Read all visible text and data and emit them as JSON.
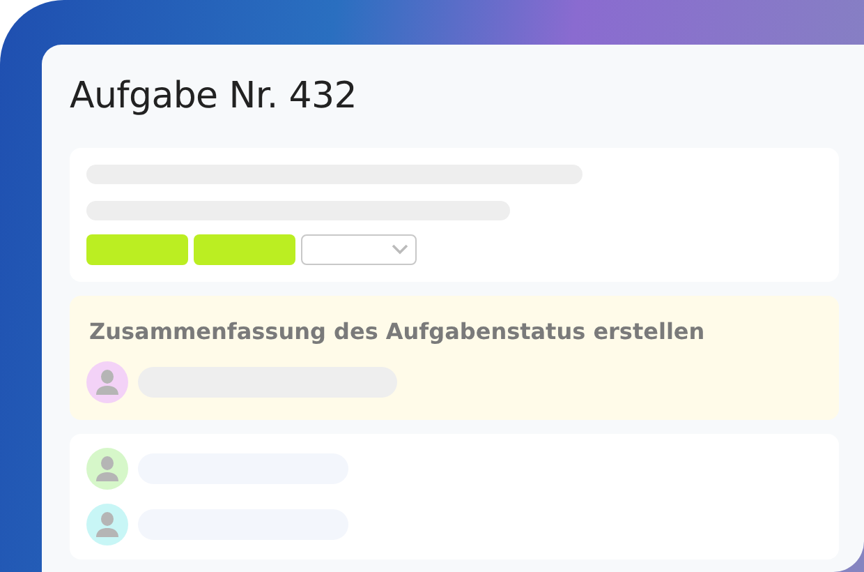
{
  "task": {
    "title": "Aufgabe Nr. 432"
  },
  "summary": {
    "title": "Zusammenfassung des Aufgabenstatus erstellen",
    "assignee": {
      "color": "#f3d2f7"
    }
  },
  "assignees": [
    {
      "color": "#d6f7c9"
    },
    {
      "color": "#c8f6f6"
    }
  ]
}
